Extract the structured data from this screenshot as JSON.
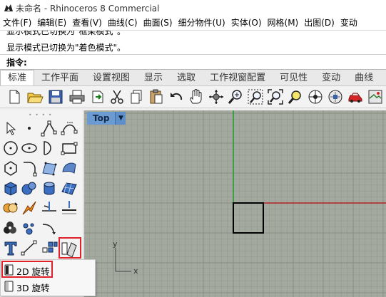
{
  "window": {
    "title": "未命名 - Rhinoceros 8 Commercial",
    "icon": "rhino-logo-icon"
  },
  "menu": [
    "文件(F)",
    "编辑(E)",
    "查看(V)",
    "曲线(C)",
    "曲面(S)",
    "细分物件(U)",
    "实体(O)",
    "网格(M)",
    "出图(D)",
    "变动"
  ],
  "history": [
    "显示模式已切换为\"框架模式\"。",
    "显示模式已切换为\"着色模式\"。"
  ],
  "command": {
    "label": "指令:",
    "value": ""
  },
  "tabs": [
    {
      "label": "标准",
      "active": true
    },
    {
      "label": "工作平面",
      "active": false
    },
    {
      "label": "设置视图",
      "active": false
    },
    {
      "label": "显示",
      "active": false
    },
    {
      "label": "选取",
      "active": false
    },
    {
      "label": "工作视窗配置",
      "active": false
    },
    {
      "label": "可见性",
      "active": false
    },
    {
      "label": "变动",
      "active": false
    },
    {
      "label": "曲线",
      "active": false
    }
  ],
  "toolbar_icons": [
    "new-document-icon",
    "open-folder-icon",
    "save-icon",
    "print-icon",
    "import-icon",
    "cut-icon",
    "copy-icon",
    "paste-icon",
    "undo-icon",
    "pan-hand-icon",
    "rotate-view-icon",
    "zoom-icon",
    "zoom-window-icon",
    "zoom-extents-icon",
    "zoom-selected-icon",
    "select-icon",
    "car-render-icon",
    "render-icon"
  ],
  "palette_icons": [
    "select-arrow-icon",
    "point-icon",
    "polyline-icon",
    "curve-icon",
    "circle-icon",
    "ellipse-icon",
    "arc-icon",
    "rectangle-icon",
    "polygon-icon",
    "fillet-curve-icon",
    "surface-from-points-icon",
    "patch-surface-icon",
    "box-solid-icon",
    "sphere-icon",
    "cylinder-icon",
    "mesh-icon",
    "boolean-icon",
    "explode-icon",
    "trim-icon",
    "split-icon",
    "join-icon",
    "blob-icon",
    "bend-icon",
    "group-icon",
    "text-icon",
    "dimension-icon",
    "array-icon",
    "rotate-2d-icon"
  ],
  "viewport": {
    "name": "Top",
    "dropdown_icon": "dropdown-triangle-icon",
    "axis_y": "y",
    "axis_x": "x"
  },
  "flyout": [
    {
      "label": "2D 旋转",
      "icon": "rotate-2d-icon",
      "highlighted": true
    },
    {
      "label": "3D 旋转",
      "icon": "rotate-3d-icon",
      "highlighted": false
    }
  ],
  "colors": {
    "viewport_bg": "#a3a99f",
    "grid_line": "#959b91",
    "x_axis": "#b22222",
    "y_axis": "#1e9c28",
    "highlight": "#e0202a",
    "viewport_tab": "#6b9bd1"
  }
}
